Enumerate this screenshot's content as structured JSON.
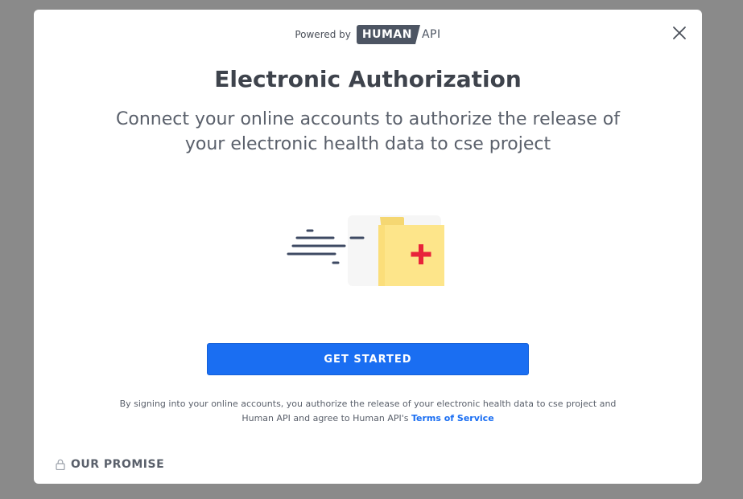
{
  "modal": {
    "powered_by": "Powered by",
    "logo": {
      "human": "HUMAN",
      "api": "API"
    },
    "title": "Electronic Authorization",
    "subtitle": "Connect your online accounts to authorize the release of your electronic health data to cse project",
    "cta_label": "GET STARTED",
    "disclaimer_text": "By signing into your online accounts, you authorize the release of your electronic health data to cse project and Human API and agree to Human API's ",
    "tos_link": "Terms of Service",
    "promise_label": "OUR PROMISE"
  },
  "icons": {
    "close": "close-icon",
    "lock": "lock-icon",
    "illustration": "health-folder-illustration"
  },
  "colors": {
    "backdrop": "#8a8a8a",
    "primary": "#1a6ef2",
    "text_dark": "#3e434c",
    "folder": "#fde58a",
    "cross": "#e8233a"
  }
}
